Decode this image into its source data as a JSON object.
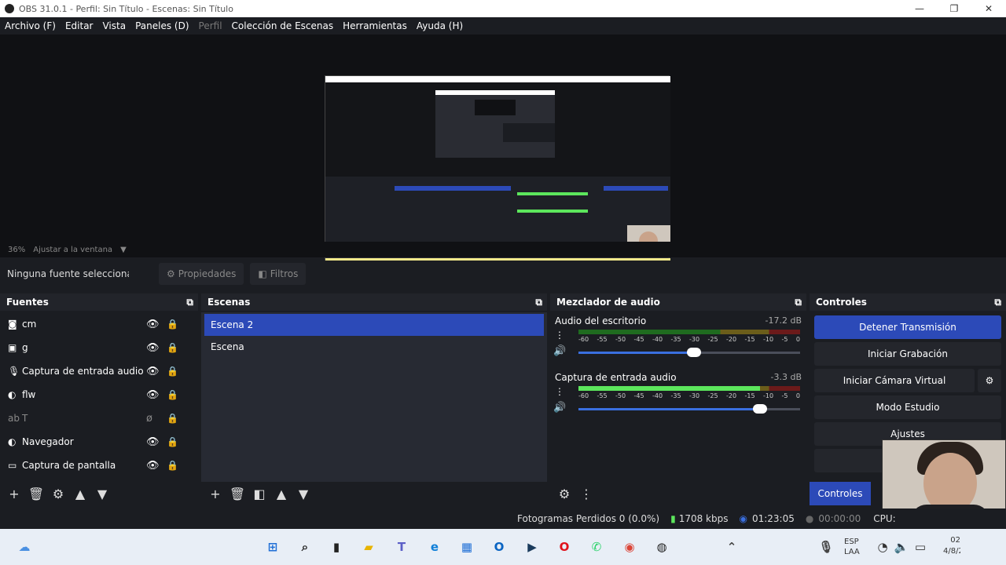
{
  "window": {
    "title": "OBS 31.0.1 - Perfil: Sin Título - Escenas: Sin Título",
    "min": "—",
    "max": "❐",
    "close": "✕"
  },
  "menu": [
    "Archivo (F)",
    "Editar",
    "Vista",
    "Paneles (D)",
    "Perfil",
    "Colección de Escenas",
    "Herramientas",
    "Ayuda (H)"
  ],
  "zoom": {
    "level": "36%",
    "fit": "Ajustar a la ventana"
  },
  "props": {
    "no_selection": "Ninguna fuente seleccionada",
    "properties": "Propiedades",
    "filters": "Filtros"
  },
  "sources": {
    "title": "Fuentes",
    "items": [
      {
        "label": "cm",
        "icon": "camera-icon",
        "visible": "👁"
      },
      {
        "label": "g",
        "icon": "image-icon",
        "visible": "👁"
      },
      {
        "label": "Captura de entrada audio",
        "icon": "microphone-icon",
        "visible": "👁"
      },
      {
        "label": "flw",
        "icon": "browser-icon",
        "visible": "👁"
      },
      {
        "label": "T",
        "icon": "text-icon",
        "visible": "ø"
      },
      {
        "label": "Navegador",
        "icon": "browser-icon",
        "visible": "👁"
      },
      {
        "label": "Captura de pantalla",
        "icon": "monitor-icon",
        "visible": "👁"
      }
    ]
  },
  "scenes": {
    "title": "Escenas",
    "items": [
      "Escena 2",
      "Escena"
    ]
  },
  "mixer": {
    "title": "Mezclador de audio",
    "channels": [
      {
        "name": "Audio del escritorio",
        "db": "-17.2 dB",
        "level": 0.0,
        "volume": 0.52
      },
      {
        "name": "Captura de entrada audio",
        "db": "-3.3 dB",
        "level": 0.82,
        "volume": 0.82
      }
    ],
    "scale": [
      "-60",
      "-55",
      "-50",
      "-45",
      "-40",
      "-35",
      "-30",
      "-25",
      "-20",
      "-15",
      "-10",
      "-5",
      "0"
    ]
  },
  "controls": {
    "title": "Controles",
    "stop_stream": "Detener Transmisión",
    "start_rec": "Iniciar Grabación",
    "virtual_cam": "Iniciar Cámara Virtual",
    "studio": "Modo Estudio",
    "settings": "Ajustes",
    "tab": "Controles"
  },
  "status": {
    "dropped": "Fotogramas Perdidos 0 (0.0%)",
    "bitrate": "1708 kbps",
    "stream_time": "01:23:05",
    "rec_time": "00:00:00",
    "cpu": "CPU:"
  },
  "taskbar": {
    "lang1": "ESP",
    "lang2": "LAA",
    "clock": "02",
    "date": "4/8/2"
  },
  "colors": {
    "accent": "#2c4ab8",
    "bg": "#1b1d22",
    "panel": "#272a33"
  }
}
